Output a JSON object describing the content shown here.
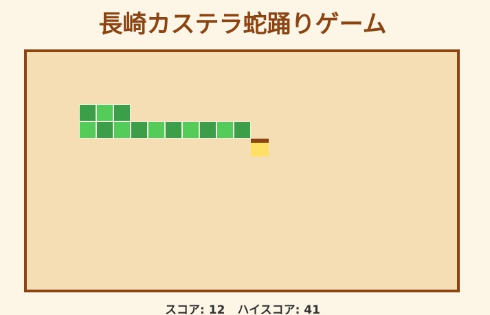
{
  "title": "長崎カステラ蛇踊りゲーム",
  "colors": {
    "background": "#fdf5e6",
    "title": "#8b4513",
    "board_fill": "#f5deb3",
    "board_border": "#8b4513",
    "snake_light": "#55cc5a",
    "snake_dark": "#3d9e4a",
    "castella_crust": "#8b4513",
    "castella_sponge": "#ffe066"
  },
  "game": {
    "snake": [
      {
        "col": 3,
        "row": 3,
        "shade": "dark"
      },
      {
        "col": 4,
        "row": 3,
        "shade": "light"
      },
      {
        "col": 5,
        "row": 3,
        "shade": "dark"
      },
      {
        "col": 3,
        "row": 4,
        "shade": "light"
      },
      {
        "col": 4,
        "row": 4,
        "shade": "dark"
      },
      {
        "col": 5,
        "row": 4,
        "shade": "light"
      },
      {
        "col": 6,
        "row": 4,
        "shade": "dark"
      },
      {
        "col": 7,
        "row": 4,
        "shade": "light"
      },
      {
        "col": 8,
        "row": 4,
        "shade": "dark"
      },
      {
        "col": 9,
        "row": 4,
        "shade": "light"
      },
      {
        "col": 10,
        "row": 4,
        "shade": "dark"
      },
      {
        "col": 11,
        "row": 4,
        "shade": "light"
      },
      {
        "col": 12,
        "row": 4,
        "shade": "dark"
      }
    ],
    "food": {
      "col": 13,
      "row": 5,
      "icon": "castella-icon"
    }
  },
  "score": {
    "label": "スコア:",
    "value": "12",
    "high_label": "ハイスコア:",
    "high_value": "41"
  }
}
